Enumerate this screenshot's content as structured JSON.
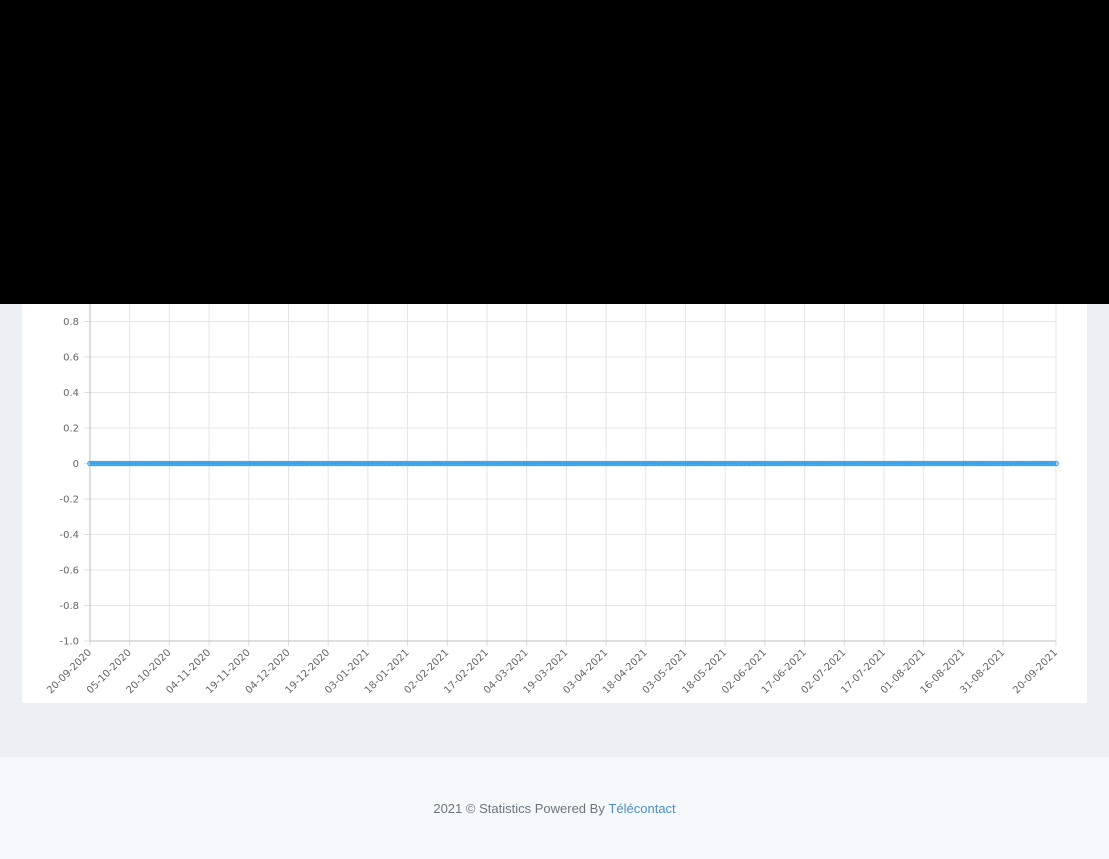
{
  "chart_data": {
    "type": "line",
    "ylim": [
      -1.0,
      1.0
    ],
    "y_ticks": [
      0.8,
      0.6,
      0.4,
      0.2,
      0,
      -0.2,
      -0.4,
      -0.6,
      -0.8,
      -1.0
    ],
    "y_tick_labels": [
      "0.8",
      "0.6",
      "0.4",
      "0.2",
      "0",
      "-0.2",
      "-0.4",
      "-0.6",
      "-0.8",
      "-1.0"
    ],
    "x_range": [
      "2020-09-20",
      "2021-09-20"
    ],
    "x_tick_labels": [
      "20-09-2020",
      "05-10-2020",
      "20-10-2020",
      "04-11-2020",
      "19-11-2020",
      "04-12-2020",
      "19-12-2020",
      "03-01-2021",
      "18-01-2021",
      "02-02-2021",
      "17-02-2021",
      "04-03-2021",
      "19-03-2021",
      "03-04-2021",
      "18-04-2021",
      "03-05-2021",
      "18-05-2021",
      "02-06-2021",
      "17-06-2021",
      "02-07-2021",
      "17-07-2021",
      "01-08-2021",
      "16-08-2021",
      "31-08-2021",
      "20-09-2021"
    ],
    "series": [
      {
        "color": "#36a2eb",
        "constant_value": 0,
        "x_from": "2020-09-20",
        "x_to": "2021-09-20",
        "interval": "daily"
      }
    ],
    "grid": true,
    "xlabel": "",
    "ylabel": ""
  },
  "footer": {
    "year": "2021",
    "copyright": "©",
    "powered_by": "Statistics Powered By",
    "brand": "Télécontact"
  }
}
